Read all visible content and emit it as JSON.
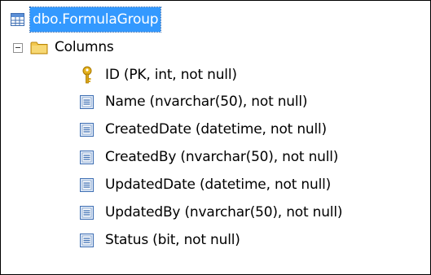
{
  "colors": {
    "selection": "#3399ff",
    "folder": "#f3c84f",
    "key": "#e5b11d",
    "column_icon": "#3f6fb3"
  },
  "tree": {
    "root": {
      "label": "dbo.FormulaGroup",
      "icon": "table-icon",
      "selected": true
    },
    "folder": {
      "label": "Columns",
      "icon": "folder-icon",
      "expanded": true
    },
    "columns": [
      {
        "label": "ID (PK, int, not null)",
        "icon": "primary-key-icon"
      },
      {
        "label": "Name (nvarchar(50), not null)",
        "icon": "column-icon"
      },
      {
        "label": "CreatedDate (datetime, not null)",
        "icon": "column-icon"
      },
      {
        "label": "CreatedBy (nvarchar(50), not null)",
        "icon": "column-icon"
      },
      {
        "label": "UpdatedDate (datetime, not null)",
        "icon": "column-icon"
      },
      {
        "label": "UpdatedBy (nvarchar(50), not null)",
        "icon": "column-icon"
      },
      {
        "label": "Status (bit, not null)",
        "icon": "column-icon"
      }
    ]
  }
}
